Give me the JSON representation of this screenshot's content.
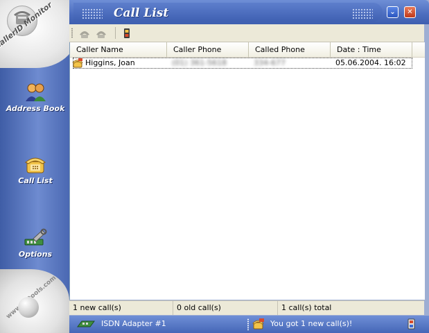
{
  "app": {
    "logo_text": "CallerID Monitor",
    "website": "www.st-tools.com"
  },
  "title": {
    "text": "Call List",
    "minimize_glyph": "⌄",
    "close_glyph": "✕"
  },
  "sidebar": {
    "items": [
      {
        "label": "Address Book",
        "icon": "address-book-icon"
      },
      {
        "label": "Call List",
        "icon": "phone-icon"
      },
      {
        "label": "Options",
        "icon": "options-tools-icon"
      }
    ]
  },
  "toolbar": {
    "buttons": [
      {
        "icon": "delete-call-icon",
        "enabled": false
      },
      {
        "icon": "delete-all-icon",
        "enabled": false
      },
      {
        "icon": "call-info-icon",
        "enabled": true
      }
    ]
  },
  "list": {
    "columns": [
      "Caller Name",
      "Caller Phone",
      "Called Phone",
      "Date  :  Time"
    ],
    "rows": [
      {
        "caller_name": "Higgins, Joan",
        "caller_phone": "(01) 361-5618",
        "called_phone": "334-677",
        "datetime": "05.06.2004.  16:02",
        "icon": "new-call-icon"
      }
    ]
  },
  "status": {
    "new_calls": "1 new call(s)",
    "old_calls": "0 old call(s)",
    "total_calls": "1 call(s) total"
  },
  "infobar": {
    "adapter": "ISDN Adapter #1",
    "message": "You got 1 new call(s)!"
  },
  "colors": {
    "sidebar_blue": "#5676c2",
    "title_blue": "#4c6dbe",
    "panel_beige": "#ece9d8"
  }
}
